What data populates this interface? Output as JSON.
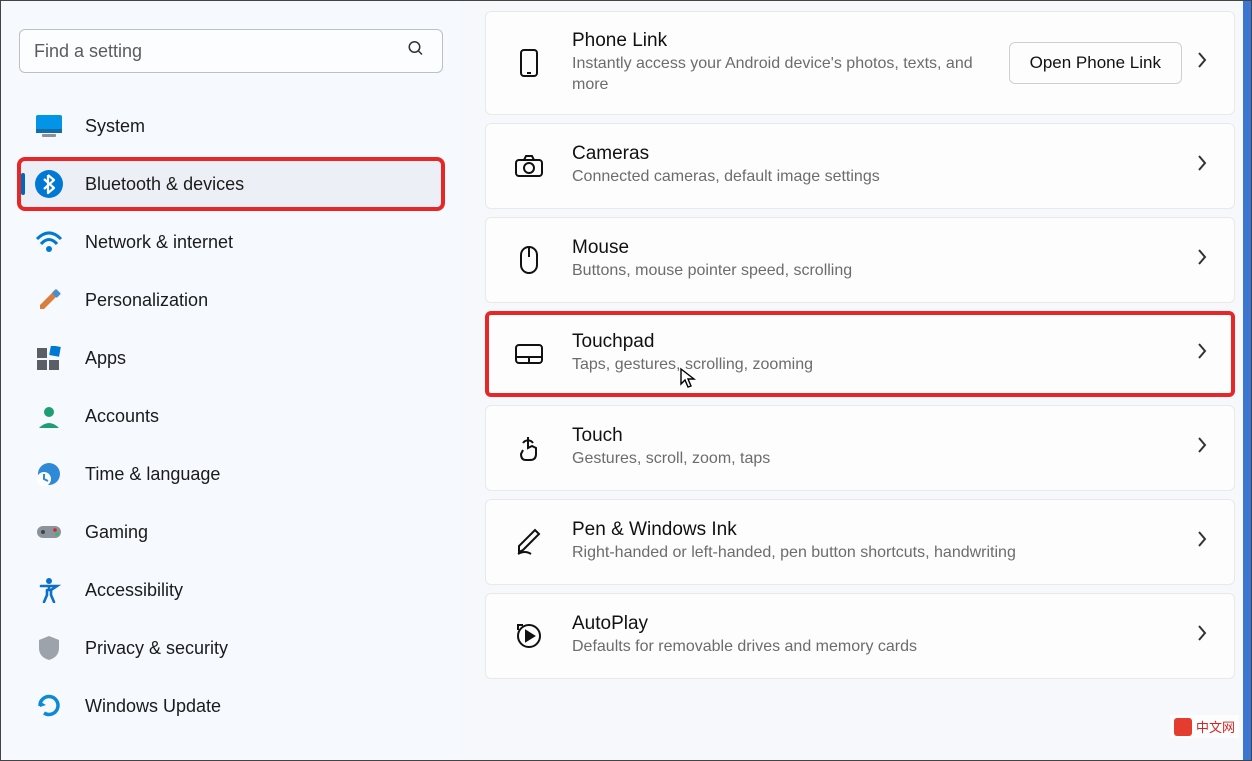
{
  "search": {
    "placeholder": "Find a setting"
  },
  "sidebar": {
    "items": [
      {
        "label": "System",
        "icon": "system"
      },
      {
        "label": "Bluetooth & devices",
        "icon": "bluetooth",
        "active": true,
        "highlighted": true
      },
      {
        "label": "Network & internet",
        "icon": "wifi"
      },
      {
        "label": "Personalization",
        "icon": "paint"
      },
      {
        "label": "Apps",
        "icon": "apps"
      },
      {
        "label": "Accounts",
        "icon": "person"
      },
      {
        "label": "Time & language",
        "icon": "globe"
      },
      {
        "label": "Gaming",
        "icon": "gamepad"
      },
      {
        "label": "Accessibility",
        "icon": "accessibility"
      },
      {
        "label": "Privacy & security",
        "icon": "shield"
      },
      {
        "label": "Windows Update",
        "icon": "update"
      }
    ]
  },
  "cards": [
    {
      "title": "Phone Link",
      "desc": "Instantly access your Android device's photos, texts, and more",
      "icon": "phone",
      "action_label": "Open Phone Link"
    },
    {
      "title": "Cameras",
      "desc": "Connected cameras, default image settings",
      "icon": "camera"
    },
    {
      "title": "Mouse",
      "desc": "Buttons, mouse pointer speed, scrolling",
      "icon": "mouse"
    },
    {
      "title": "Touchpad",
      "desc": "Taps, gestures, scrolling, zooming",
      "icon": "touchpad",
      "highlighted": true
    },
    {
      "title": "Touch",
      "desc": "Gestures, scroll, zoom, taps",
      "icon": "touch"
    },
    {
      "title": "Pen & Windows Ink",
      "desc": "Right-handed or left-handed, pen button shortcuts, handwriting",
      "icon": "pen"
    },
    {
      "title": "AutoPlay",
      "desc": "Defaults for removable drives and memory cards",
      "icon": "autoplay"
    }
  ],
  "watermark": "中文网"
}
